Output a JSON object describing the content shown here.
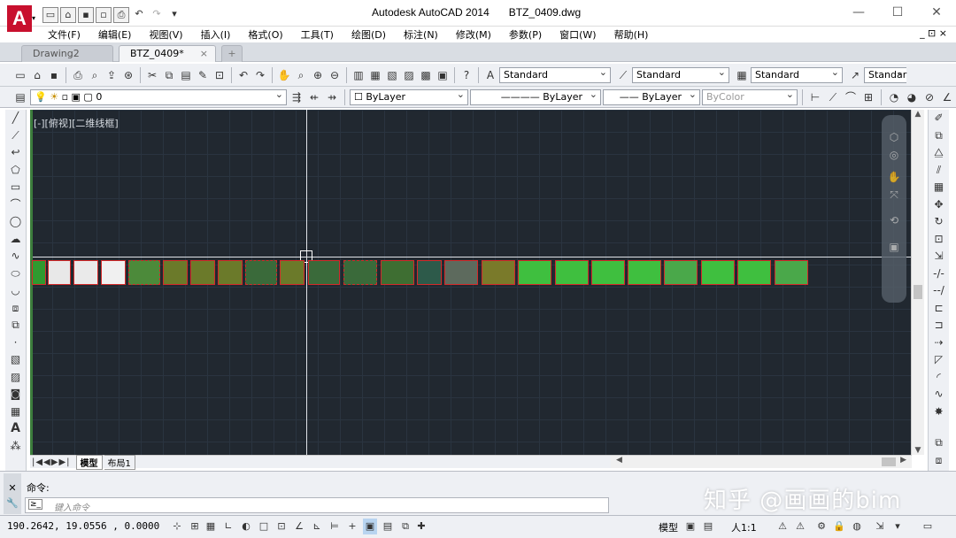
{
  "title_bar": {
    "logo_letter": "A",
    "app_name": "Autodesk AutoCAD 2014",
    "file_name": "BTZ_0409.dwg",
    "controls": [
      "—",
      "☐",
      "✕"
    ]
  },
  "menu": [
    "文件(F)",
    "编辑(E)",
    "视图(V)",
    "插入(I)",
    "格式(O)",
    "工具(T)",
    "绘图(D)",
    "标注(N)",
    "修改(M)",
    "参数(P)",
    "窗口(W)",
    "帮助(H)"
  ],
  "mdi_controls": "_ ⊡ ×",
  "tabs": [
    {
      "label": "Drawing2",
      "active": false
    },
    {
      "label": "BTZ_0409*",
      "active": true,
      "close": "×"
    }
  ],
  "styles_toolbar": {
    "text_style": "Standard",
    "dim_style": "Standard",
    "table_style": "Standard",
    "mleader_style": "Standar"
  },
  "layer_toolbar": {
    "layer": "0",
    "color": "ByLayer",
    "linetype": "ByLayer",
    "lineweight": "ByLayer",
    "plotstyle": "ByColor"
  },
  "viewport_label": "[-][俯视][二维线框]",
  "layout_tabs": [
    "模型",
    "布局1"
  ],
  "command": {
    "history": "命令:",
    "placeholder": "键入命令",
    "prompt_icon": "≥_"
  },
  "status": {
    "coordinates": "190.2642,  19.0556  ,  0.0000",
    "model_label": "模型",
    "scale": "人1:1"
  },
  "watermark": "知乎 @画画的bim"
}
